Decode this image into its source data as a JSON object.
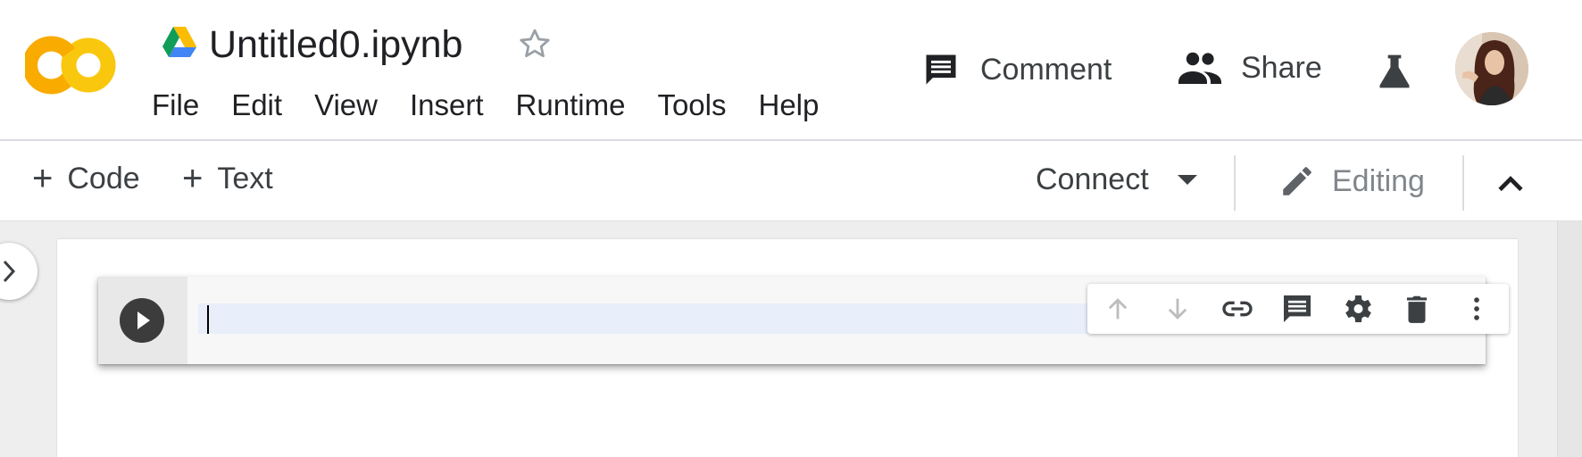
{
  "app": {
    "logo_text": "CO",
    "notebook_title": "Untitled0.ipynb"
  },
  "menu": {
    "items": [
      {
        "label": "File"
      },
      {
        "label": "Edit"
      },
      {
        "label": "View"
      },
      {
        "label": "Insert"
      },
      {
        "label": "Runtime"
      },
      {
        "label": "Tools"
      },
      {
        "label": "Help"
      }
    ]
  },
  "header_actions": {
    "comment_label": "Comment",
    "share_label": "Share"
  },
  "toolbar": {
    "add_code_label": "Code",
    "add_text_label": "Text",
    "connect_label": "Connect",
    "editing_label": "Editing"
  },
  "cell": {
    "source": ""
  },
  "icons": {
    "drive": "google-drive-icon",
    "star": "star-outline-icon",
    "comment": "comment-icon",
    "share": "people-icon",
    "labs": "flask-icon",
    "edit": "pencil-icon",
    "collapse": "chevron-up-icon",
    "sidebar": "chevron-right-icon",
    "run": "play-icon",
    "cell_toolbar": [
      "arrow-up-icon",
      "arrow-down-icon",
      "link-icon",
      "comment-icon",
      "gear-icon",
      "trash-icon",
      "more-vert-icon"
    ]
  },
  "colors": {
    "logo_primary": "#F9AB00",
    "logo_secondary": "#F9C80E",
    "text": "#202124",
    "muted": "#80868B",
    "editor_highlight": "#E8EEFA",
    "background": "#EEEEEE"
  }
}
